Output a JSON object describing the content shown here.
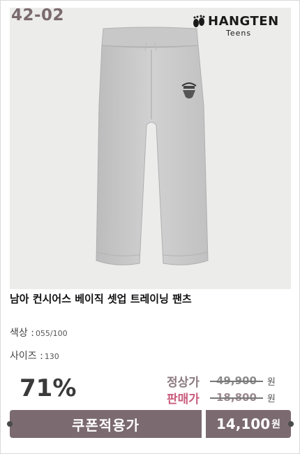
{
  "product": {
    "code": "42-02",
    "brand": {
      "name": "HANGTEN",
      "sub": "Teens",
      "logo": "footprints-icon"
    },
    "title": "남아 컨시어스 베이직 셋업 트레이닝 팬츠",
    "image": "grey-sweatpants",
    "options": [
      {
        "label": "색상 :",
        "value": "055/100"
      },
      {
        "label": "사이즈 :",
        "value": "130"
      }
    ]
  },
  "pricing": {
    "discount": "71%",
    "regular_label": "정상가",
    "regular_price": "49,900",
    "sale_label": "판매가",
    "sale_price": "18,800",
    "currency": "원",
    "coupon_label": "쿠폰적용가",
    "final_price": "14,100",
    "final_unit": "원"
  },
  "colors": {
    "accent": "#7b6a70",
    "sale_label": "#c85c7c",
    "photo_bg": "#ececea"
  }
}
